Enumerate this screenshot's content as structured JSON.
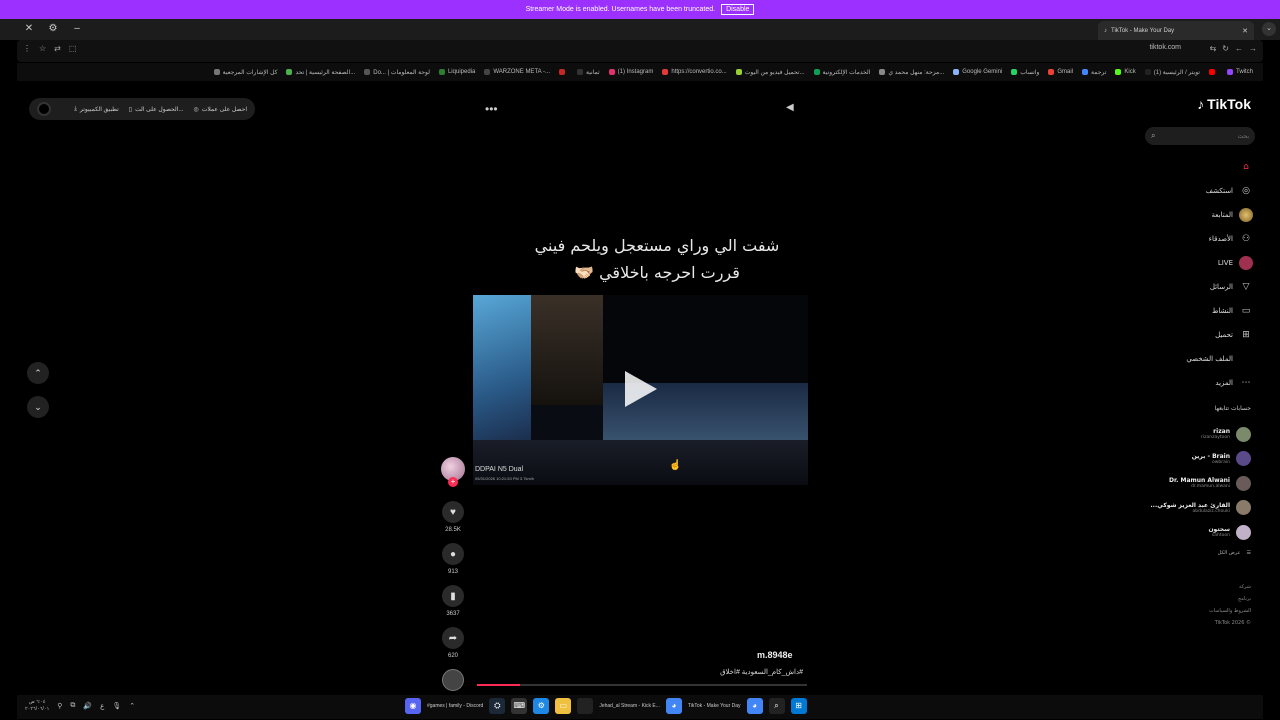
{
  "streamer_banner": {
    "message": "Streamer Mode is enabled. Usernames have been truncated.",
    "disable_label": "Disable",
    "color": "#9b30ff"
  },
  "window": {
    "tab_title": "TikTok - Make Your Day",
    "close_glyph": "✕",
    "settings_glyph": "⚙",
    "minimize_glyph": "–",
    "new_tab_glyph": "+",
    "tab_list_glyph": "⌄"
  },
  "toolbar": {
    "url": "tiktok.com",
    "left_icons": [
      "⋮",
      "☆",
      "⇄",
      "⬚"
    ],
    "right_icons": [
      "⇆",
      "↻",
      "←",
      "→"
    ]
  },
  "bookmarks": [
    {
      "label": "Twitch",
      "color": "#9146ff"
    },
    {
      "label": "",
      "color": "#ff0000"
    },
    {
      "label": "(1) تويتر / الرئيسية",
      "color": "#222222"
    },
    {
      "label": "Kick",
      "color": "#53fc18"
    },
    {
      "label": "ترجمة",
      "color": "#4285f4"
    },
    {
      "label": "Gmail",
      "color": "#ea4335"
    },
    {
      "label": "واتساب",
      "color": "#25d366"
    },
    {
      "label": "Google Gemini",
      "color": "#8ab4f8"
    },
    {
      "label": "مزحة: منهل محمد ي...",
      "color": "#888888"
    },
    {
      "label": "الخدمات الإلكترونية",
      "color": "#0f9d58"
    },
    {
      "label": "تحميل فيديو من اليوت...",
      "color": "#9acd32"
    },
    {
      "label": "https://convertio.co...",
      "color": "#e53935"
    },
    {
      "label": "(1) Instagram",
      "color": "#e1306c"
    },
    {
      "label": "ثمانية",
      "color": "#333333"
    },
    {
      "label": "",
      "color": "#c62828"
    },
    {
      "label": "WARZONE META -...",
      "color": "#444444"
    },
    {
      "label": "Liquipedia",
      "color": "#2e7d32"
    },
    {
      "label": "Do... | لوحة المعلومات",
      "color": "#555555"
    },
    {
      "label": "الصفحة الرئيسية | تحد...",
      "color": "#4caf50"
    },
    {
      "label": "كل الإشارات المرجعية",
      "color": "#777777"
    }
  ],
  "get_bar": {
    "items": [
      "احصل على عملات",
      "الحصول على الت...",
      "تطبيق الكمبيوتر"
    ],
    "icons": [
      "◎",
      "▯",
      "⤓"
    ]
  },
  "caption": {
    "line1": "شفت الي وراي مستعجل ويلحم فيني",
    "line2": "قررت احرجه باخلاقي 🫱🏻‍🫲🏼"
  },
  "video": {
    "dashcam_brand": "DDPAI N5 Dual",
    "dashcam_time": "05/31/2026 10:21:53 PM 3.7km/h",
    "progress": 0.13
  },
  "actions": {
    "likes": "28.5K",
    "comments": "913",
    "saves": "3637",
    "shares": "620"
  },
  "post": {
    "author": "m.8948e",
    "hashtags": "#داش_كام_السعودية #اخلاق"
  },
  "sidebar": {
    "logo": "TikTok",
    "search_placeholder": "بحث",
    "nav": [
      {
        "label": "",
        "icon": "⌂",
        "active": true,
        "kind": "home"
      },
      {
        "label": "استكشف",
        "icon": "◎",
        "kind": "plain"
      },
      {
        "label": "المتابعة",
        "icon": "",
        "kind": "avatar-gold"
      },
      {
        "label": "الأصدقاء",
        "icon": "⚇",
        "kind": "plain"
      },
      {
        "label": "LIVE",
        "icon": "",
        "kind": "live-badge"
      },
      {
        "label": "الرسائل",
        "icon": "▽",
        "kind": "plain"
      },
      {
        "label": "النشاط",
        "icon": "▭",
        "kind": "plain"
      },
      {
        "label": "تحميل",
        "icon": "⊞",
        "kind": "plain"
      },
      {
        "label": "الملف الشخصي",
        "icon": "",
        "kind": "plain"
      },
      {
        "label": "المزيد",
        "icon": "⋯",
        "kind": "plain"
      }
    ],
    "following_title": "حسابات تتابعها",
    "following": [
      {
        "name": "rizan",
        "handle": "rizanzaytoon",
        "color": "#7a8a6a"
      },
      {
        "name": "Brain - برين",
        "handle": "owbrain",
        "color": "#5a4a8a"
      },
      {
        "name": "Dr. Mamun Alwani",
        "handle": "dr.mamun.alwani",
        "color": "#6a5a5a"
      },
      {
        "name": "القارئ عبد العزيز شوكي...",
        "handle": "abdulaziz.chouki",
        "color": "#8a7a6a"
      },
      {
        "name": "سحتون",
        "handle": "sahtoon",
        "color": "#c0b0c8"
      }
    ],
    "show_all": "عرض الكل",
    "footer": [
      "شركة",
      "برنامج",
      "الشروط والسياسات",
      "© 2026 TikTok"
    ]
  },
  "taskbar": {
    "clock_time": "٦:٠٤ ص",
    "clock_date": "٢٠٢٦/٠٦/٠١",
    "tray_icons": [
      "⌃",
      "🎙",
      "ع",
      "🔊",
      "⧉",
      "⚲"
    ],
    "tasks": [
      {
        "label": "#games | family - Discord",
        "color": "#5865f2",
        "glyph": "◉"
      },
      {
        "label": "",
        "color": "#1b2838",
        "glyph": "⛭"
      },
      {
        "label": "",
        "color": "#333333",
        "glyph": "⌨"
      },
      {
        "label": "",
        "color": "#1e88e5",
        "glyph": "⚙"
      },
      {
        "label": "",
        "color": "#f0c040",
        "glyph": "▭"
      },
      {
        "label": "Jehad_al Stream - Kick E...",
        "color": "#222222",
        "glyph": ""
      },
      {
        "label": "TikTok - Make Your Day",
        "color": "#4285f4",
        "glyph": "◕"
      },
      {
        "label": "",
        "color": "#4285f4",
        "glyph": "◕"
      },
      {
        "label": "",
        "color": "#222222",
        "glyph": "⌕"
      },
      {
        "label": "",
        "color": "#0078d4",
        "glyph": "⊞"
      }
    ]
  }
}
